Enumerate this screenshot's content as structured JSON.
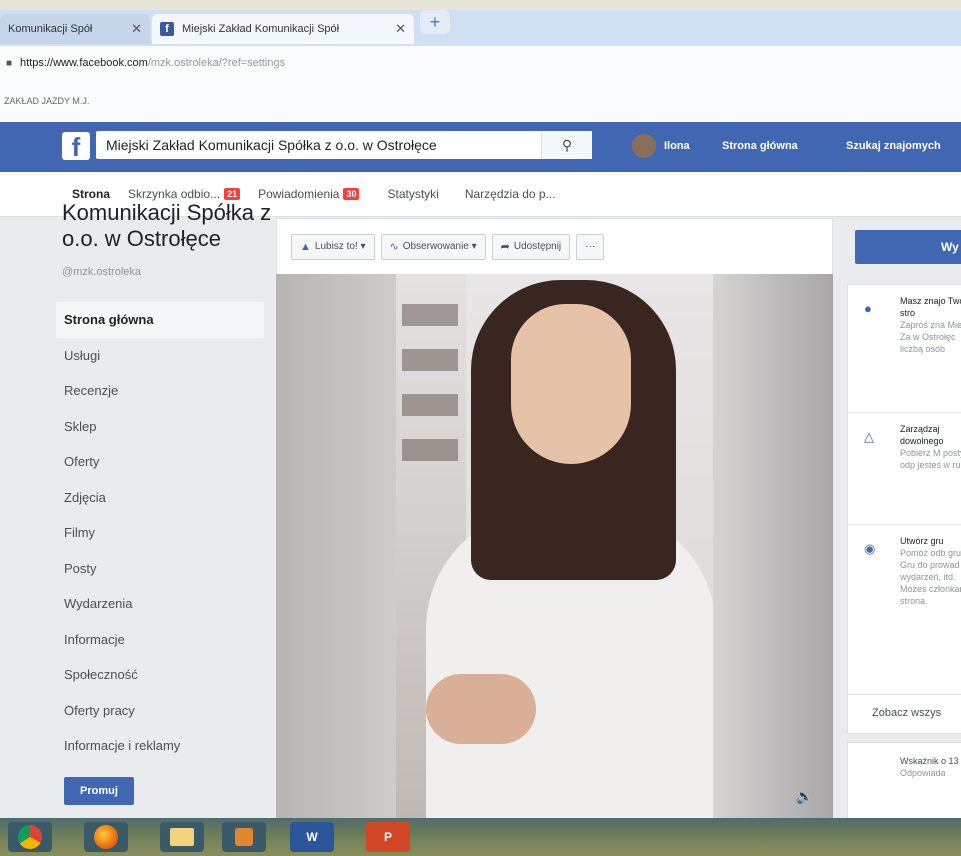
{
  "browser": {
    "tabs": [
      {
        "label": "Komunikacji Spół"
      },
      {
        "label": "Miejski Zakład Komunikacji Spół"
      }
    ],
    "new_tab": "+",
    "url_host": "https://www.facebook.com",
    "url_rest": "/mzk.ostroleka/?ref=settings",
    "bookmark": "ZAKŁAD JAZDY M.J."
  },
  "fb": {
    "logo": "f",
    "search_value": "Miejski Zakład Komunikacji Spółka z o.o. w Ostrołęce",
    "user_name": "Ilona",
    "nav_home": "Strona główna",
    "nav_find_friends": "Szukaj znajomych"
  },
  "page_tabs": [
    {
      "label": "Strona"
    },
    {
      "label": "Skrzynka odbio...",
      "badge": "21"
    },
    {
      "label": "Powiadomienia",
      "badge": "30"
    },
    {
      "label": "Statystyki"
    },
    {
      "label": "Narzędzia do p..."
    }
  ],
  "page": {
    "name": "Komunikacji Spółka z o.o. w Ostrołęce",
    "handle": "@mzk.ostroleka"
  },
  "sidebar": {
    "items": [
      {
        "label": "Strona główna"
      },
      {
        "label": "Usługi"
      },
      {
        "label": "Recenzje"
      },
      {
        "label": "Sklep"
      },
      {
        "label": "Oferty"
      },
      {
        "label": "Zdjęcia"
      },
      {
        "label": "Filmy"
      },
      {
        "label": "Posty"
      },
      {
        "label": "Wydarzenia"
      },
      {
        "label": "Informacje"
      },
      {
        "label": "Społeczność"
      },
      {
        "label": "Oferty pracy"
      },
      {
        "label": "Informacje i reklamy"
      }
    ],
    "promote": "Promuj"
  },
  "actions": {
    "like": "Lubisz to! ▾",
    "follow": "Obserwowanie ▾",
    "share": "Udostępnij",
    "more": "···"
  },
  "right": {
    "button": "Wy",
    "items": [
      {
        "title": "Masz znajo Twoją stro",
        "desc": "Zaproś zna Miejski Za w Ostrołęc liczbą osób"
      },
      {
        "title": "Zarządzaj dowolnego",
        "desc": "Pobierz M posty i odp jesteś w ru"
      },
      {
        "title": "Utwórz gru",
        "desc": "Pomóż odb grupie. Gru do prowad wydarzeń, itd. Możes członkami strona."
      }
    ],
    "see_all": "Zobacz wszys",
    "stat_title": "Wskaźnik o 13 min",
    "stat_desc": "Odpowiada"
  },
  "taskbar": {
    "items": [
      "chrome-icon",
      "firefox-icon",
      "explorer-icon",
      "media-icon",
      "W",
      "P"
    ]
  }
}
